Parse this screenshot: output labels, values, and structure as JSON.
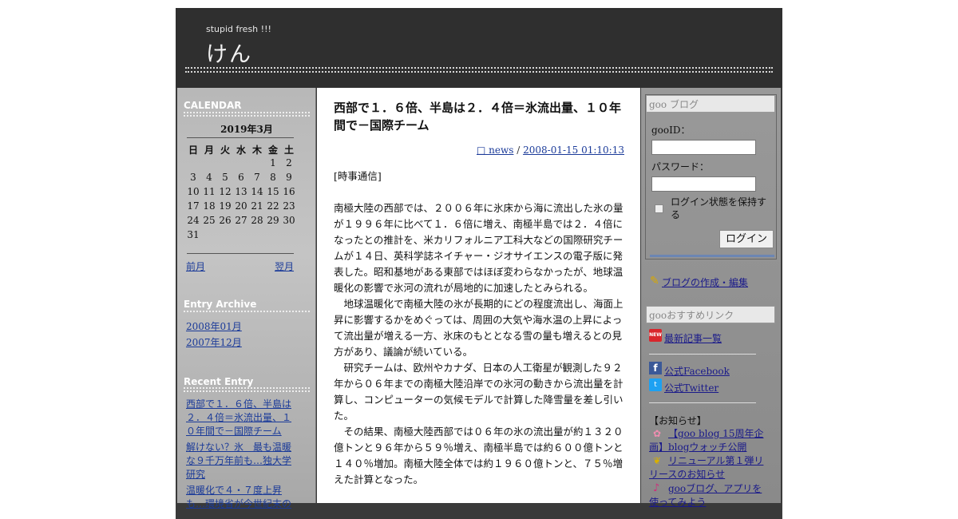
{
  "header": {
    "tagline": "stupid fresh !!!",
    "title": "けん",
    "rule": "=================================================================================================="
  },
  "calendar": {
    "section_title": "CALENDAR",
    "month": "2019年3月",
    "dow": [
      "日",
      "月",
      "火",
      "水",
      "木",
      "金",
      "土"
    ],
    "days": [
      "",
      "",
      "",
      "",
      "",
      "1",
      "2",
      "3",
      "4",
      "5",
      "6",
      "7",
      "8",
      "9",
      "10",
      "11",
      "12",
      "13",
      "14",
      "15",
      "16",
      "17",
      "18",
      "19",
      "20",
      "21",
      "22",
      "23",
      "24",
      "25",
      "26",
      "27",
      "28",
      "29",
      "30",
      "31"
    ],
    "prev": "前月",
    "next": "翌月"
  },
  "archive": {
    "section_title": "Entry Archive",
    "items": [
      "2008年01月",
      "2007年12月"
    ]
  },
  "recent": {
    "section_title": "Recent Entry",
    "items": [
      "西部で１．６倍、半島は２．４倍＝氷流出量、１０年間で－国際チーム",
      "解けない？氷　最も温暖な９千万年前も…独大学研究",
      "温暖化で４・７度上昇も…環境省が今世紀末の"
    ]
  },
  "post": {
    "title": "西部で１．６倍、半島は２．４倍＝氷流出量、１０年間で－国際チーム",
    "category": "□ news",
    "separator": " / ",
    "datetime": "2008-01-15 01:10:13",
    "source": "[時事通信]",
    "paragraphs": [
      "南極大陸の西部では、２００６年に氷床から海に流出した氷の量が１９９６年に比べて１．６倍に増え、南極半島では２．４倍になったとの推計を、米カリフォルニア工科大などの国際研究チームが１４日、英科学誌ネイチャー・ジオサイエンスの電子版に発表した。昭和基地がある東部ではほぼ変わらなかったが、地球温暖化の影響で氷河の流れが局地的に加速したとみられる。",
      "　地球温暖化で南極大陸の氷が長期的にどの程度流出し、海面上昇に影響するかをめぐっては、周囲の大気や海水温の上昇によって流出量が増える一方、氷床のもととなる雪の量も増えるとの見方があり、議論が続いている。",
      "　研究チームは、欧州やカナダ、日本の人工衛星が観測した９２年から０６年までの南極大陸沿岸での氷河の動きから流出量を計算し、コンピューターの気候モデルで計算した降雪量を差し引いた。",
      "　その結果、南極大陸西部では０６年の氷の流出量が約１３２０億トンと９６年から５９％増え、南極半島では約６００億トンと１４０％増加。南極大陸全体では約１９６０億トンと、７５％増えた計算となった。"
    ]
  },
  "goo": {
    "blog_header": "goo ブログ",
    "id_label": "gooID：",
    "password_label": "パスワード：",
    "keep_login": "ログイン状態を保持する",
    "login_button": "ログイン",
    "create_blog": "ブログの作成・編集",
    "recommend_header": "gooおすすめリンク",
    "latest": "最新記事一覧",
    "facebook": "公式Facebook",
    "twitter": "公式Twitter",
    "notice_title": "【お知らせ】",
    "notices": [
      "【goo blog 15周年企画】blogウォッチ公開",
      "リニューアル第１弾リリースのお知らせ",
      "gooブログ、アプリを使ってみよう"
    ],
    "new_badge": "NEW"
  }
}
